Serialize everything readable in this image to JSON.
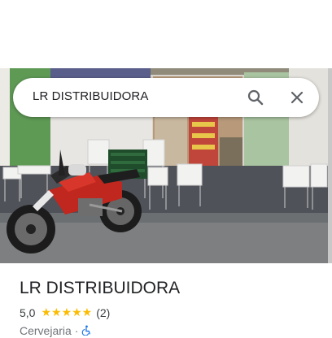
{
  "search": {
    "query": "LR DISTRIBUIDORA",
    "search_icon": "search-icon",
    "close_icon": "close-icon"
  },
  "photo": {
    "subject": "storefront-photo"
  },
  "place": {
    "name": "LR DISTRIBUIDORA",
    "rating": "5,0",
    "stars": "★★★★★",
    "review_count": "(2)",
    "category": "Cervejaria",
    "separator": "·",
    "accessibility_icon": "wheelchair-icon"
  },
  "colors": {
    "star": "#fbbc04",
    "text_primary": "#202124",
    "text_secondary": "#70757a",
    "wheelchair": "#1a73e8"
  }
}
